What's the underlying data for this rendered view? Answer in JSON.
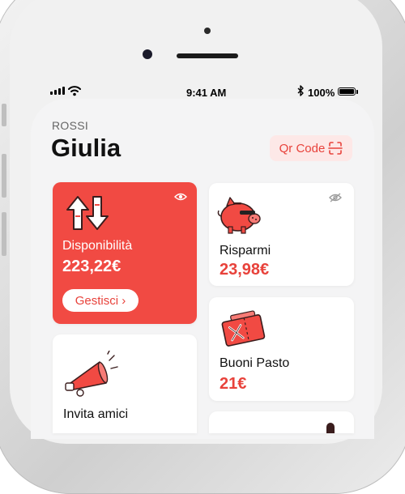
{
  "status_bar": {
    "time": "9:41 AM",
    "battery": "100%"
  },
  "user": {
    "surname": "ROSSI",
    "name": "Giulia"
  },
  "qr_button": {
    "label": "Qr Code"
  },
  "cards": {
    "disponibilita": {
      "title": "Disponibilità",
      "amount": "223,22€",
      "action": "Gestisci ›"
    },
    "risparmi": {
      "title": "Risparmi",
      "amount": "23,98€"
    },
    "buoni_pasto": {
      "title": "Buoni Pasto",
      "amount": "21€"
    },
    "invita": {
      "title": "Invita amici"
    }
  },
  "colors": {
    "accent": "#f14a43",
    "accent_text": "#e8423b",
    "accent_light": "#fde8e7"
  },
  "icons": [
    "signal-icon",
    "wifi-icon",
    "bluetooth-icon",
    "battery-icon",
    "qr-scan-icon",
    "eye-icon",
    "eye-off-icon",
    "arrows-swap-icon",
    "piggy-bank-icon",
    "meal-voucher-icon",
    "megaphone-icon"
  ]
}
